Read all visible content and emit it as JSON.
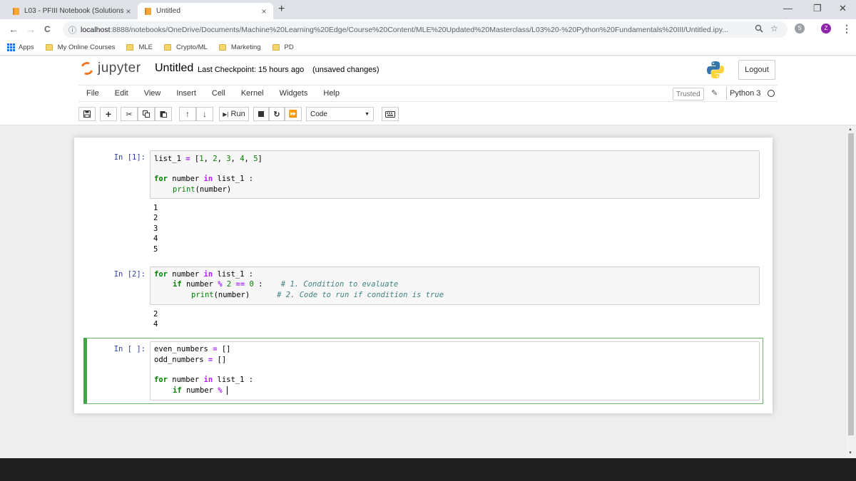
{
  "browser": {
    "tabs": [
      {
        "title": "L03 - PFIII Notebook (Solutions)",
        "close": "×"
      },
      {
        "title": "Untitled",
        "close": "×"
      }
    ],
    "new_tab": "+",
    "window_controls": [
      "—",
      "❐",
      "✕"
    ],
    "nav": {
      "back": "←",
      "forward": "→",
      "reload": "C"
    },
    "url_host": "localhost",
    "url_rest": ":8888/notebooks/OneDrive/Documents/Machine%20Learning%20Edge/Course%20Content/MLE%20Updated%20Masterclass/L03%20-%20Python%20Fundamentals%20III/Untitled.ipy...",
    "omnibox_icons": [
      "zoom-icon",
      "star-icon"
    ],
    "profile_initial": "Z",
    "menu": "⋮"
  },
  "bookmarks": [
    {
      "label": "Apps",
      "type": "apps"
    },
    {
      "label": "My Online Courses",
      "type": "folder"
    },
    {
      "label": "MLE",
      "type": "folder"
    },
    {
      "label": "Crypto/ML",
      "type": "folder"
    },
    {
      "label": "Marketing",
      "type": "folder"
    },
    {
      "label": "PD",
      "type": "folder"
    }
  ],
  "jupyter": {
    "logo_text": "jupyter",
    "notebook_name": "Untitled",
    "checkpoint": "Last Checkpoint: 15 hours ago",
    "autosave": "(unsaved changes)",
    "logout": "Logout",
    "menus": [
      "File",
      "Edit",
      "View",
      "Insert",
      "Cell",
      "Kernel",
      "Widgets",
      "Help"
    ],
    "trusted": "Trusted",
    "kernel": "Python 3",
    "toolbar": {
      "run": "Run",
      "cell_type": "Code"
    }
  },
  "cells": [
    {
      "prompt": "In [1]:",
      "outputs": [
        "1",
        "2",
        "3",
        "4",
        "5"
      ]
    },
    {
      "prompt": "In [2]:",
      "outputs": [
        "2",
        "4"
      ]
    },
    {
      "prompt": "In [ ]:"
    }
  ],
  "colors": {
    "prompt": "#303f9f",
    "keyword": "#008000",
    "operator": "#aa22ff",
    "comment": "#408080",
    "selected_border": "#42a548",
    "jupyter_orange": "#f37626"
  }
}
